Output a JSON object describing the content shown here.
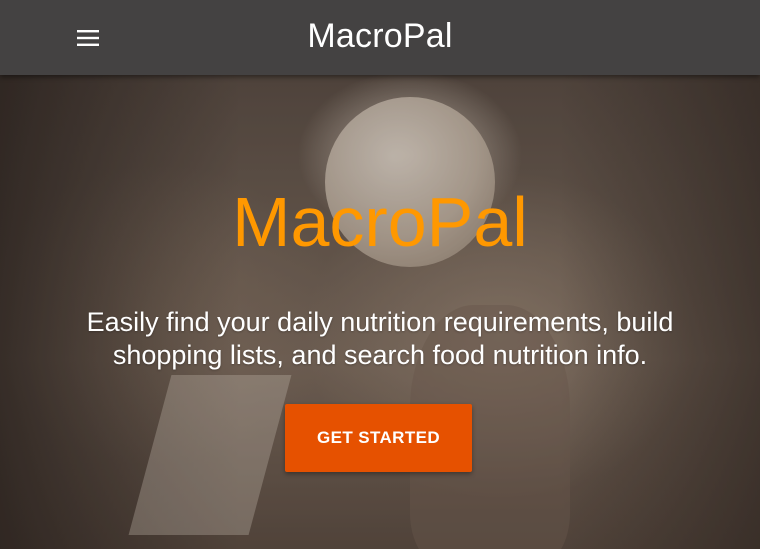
{
  "header": {
    "title": "MacroPal",
    "menu_icon": "hamburger-menu-icon"
  },
  "hero": {
    "title": "MacroPal",
    "subtitle": "Easily find your daily nutrition requirements, build shopping lists, and search food nutrition info.",
    "cta_label": "GET STARTED",
    "background": "sepia photo of woman lifting a medicine ball in a gym"
  },
  "colors": {
    "header_bg": "#444242",
    "title_accent": "#ff9800",
    "cta_bg": "#e65100",
    "text": "#ffffff"
  }
}
